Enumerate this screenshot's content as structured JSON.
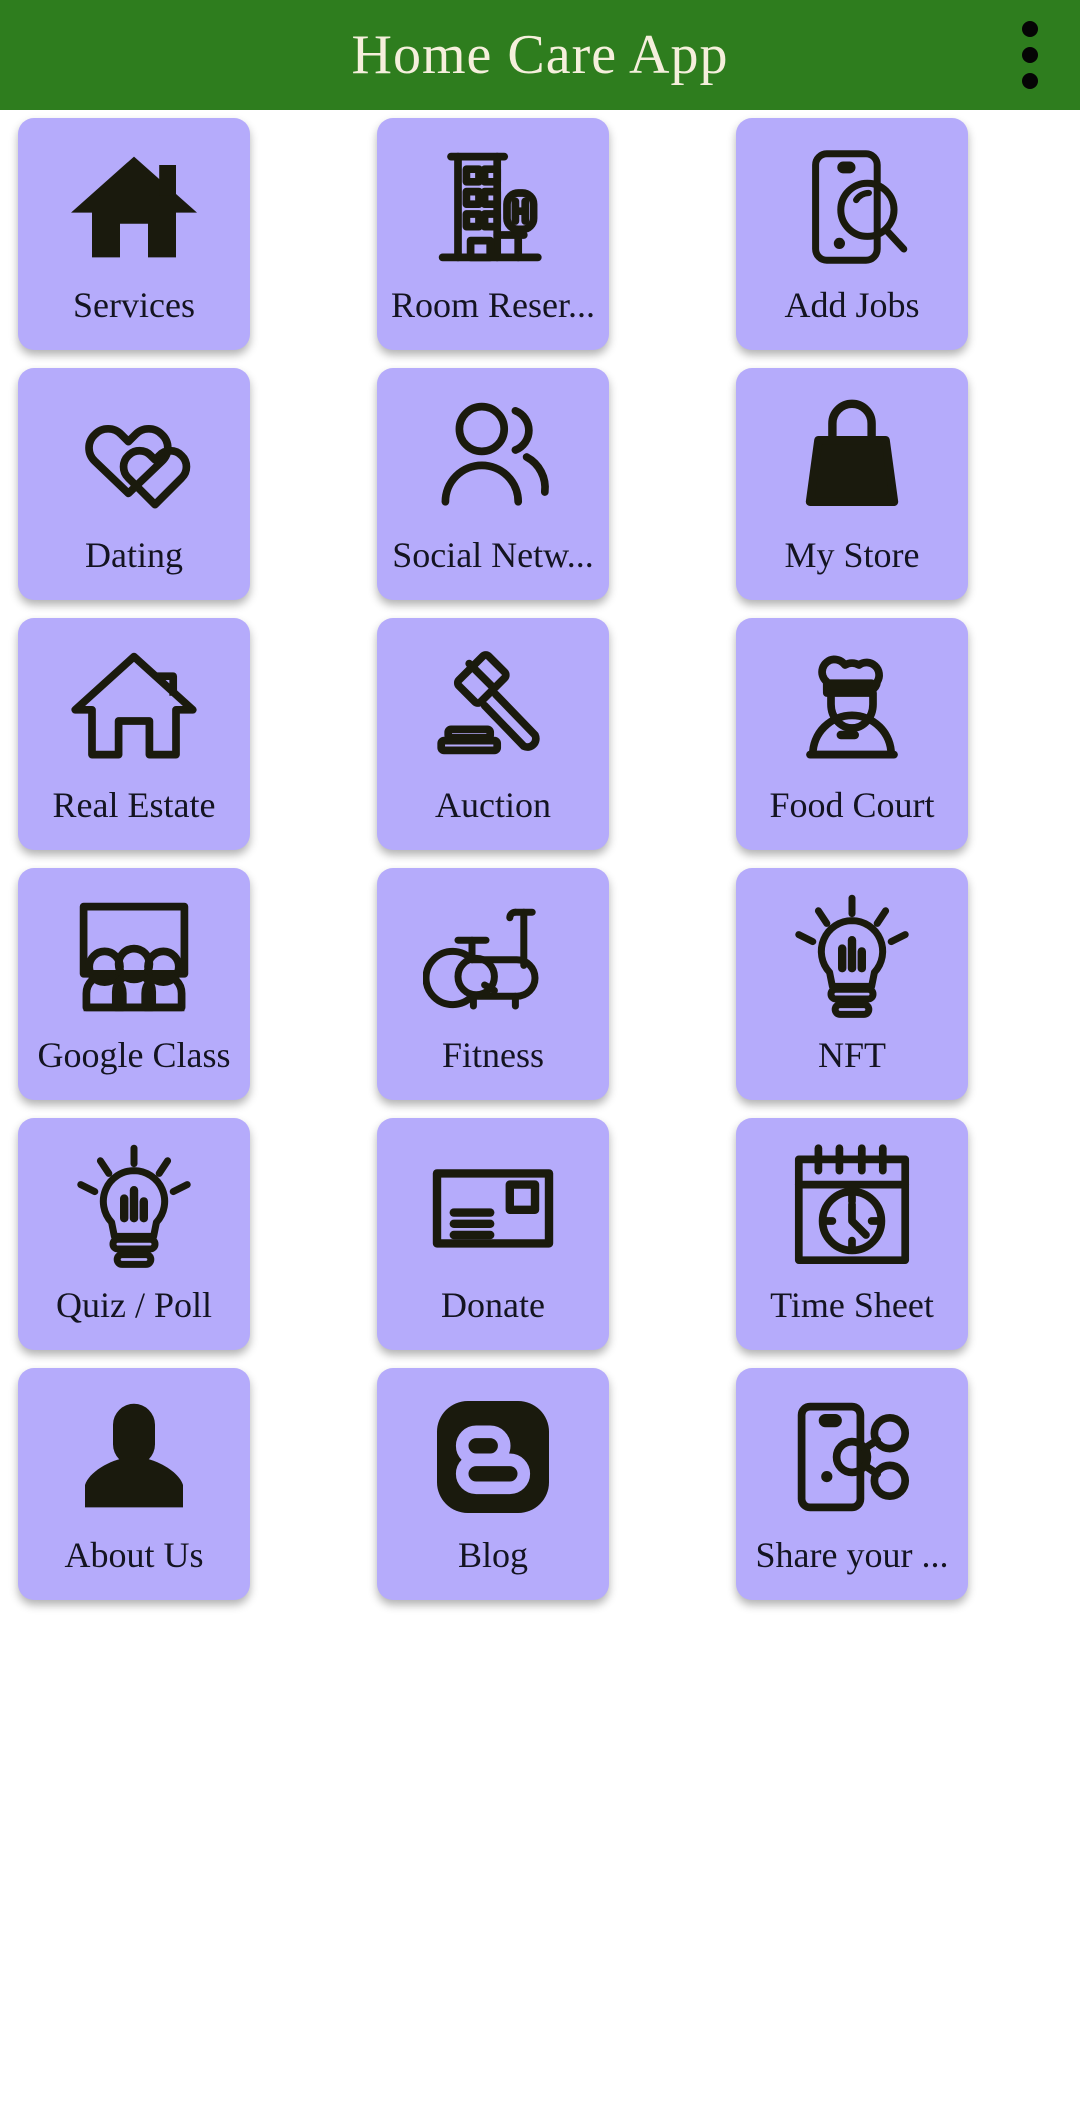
{
  "header": {
    "title": "Home Care App",
    "background_color": "#2e7d1e",
    "title_color": "#f5efdc",
    "overflow_menu_icon": "more-vert-icon"
  },
  "theme": {
    "tile_color": "#b5abfb",
    "icon_color": "#1a1a0d",
    "page_background": "#ffffff",
    "label_color": "#141421"
  },
  "grid": {
    "columns": 3,
    "tiles": [
      {
        "label": "Services",
        "icon": "home-filled-icon"
      },
      {
        "label": "Room Reser...",
        "icon": "hotel-building-icon"
      },
      {
        "label": "Add Jobs",
        "icon": "phone-search-icon"
      },
      {
        "label": "Dating",
        "icon": "two-hearts-icon"
      },
      {
        "label": "Social Netw...",
        "icon": "people-group-icon"
      },
      {
        "label": "My Store",
        "icon": "shopping-bag-icon"
      },
      {
        "label": "Real Estate",
        "icon": "home-outline-icon"
      },
      {
        "label": "Auction",
        "icon": "gavel-icon"
      },
      {
        "label": "Food Court",
        "icon": "chef-icon"
      },
      {
        "label": "Google Class",
        "icon": "classroom-icon"
      },
      {
        "label": "Fitness",
        "icon": "exercise-bike-icon"
      },
      {
        "label": "NFT",
        "icon": "lightbulb-icon"
      },
      {
        "label": "Quiz / Poll",
        "icon": "lightbulb-icon"
      },
      {
        "label": "Donate",
        "icon": "envelope-icon"
      },
      {
        "label": "Time Sheet",
        "icon": "calendar-clock-icon"
      },
      {
        "label": "About Us",
        "icon": "person-filled-icon"
      },
      {
        "label": "Blog",
        "icon": "blogger-icon"
      },
      {
        "label": "Share your ...",
        "icon": "phone-share-icon"
      }
    ]
  }
}
